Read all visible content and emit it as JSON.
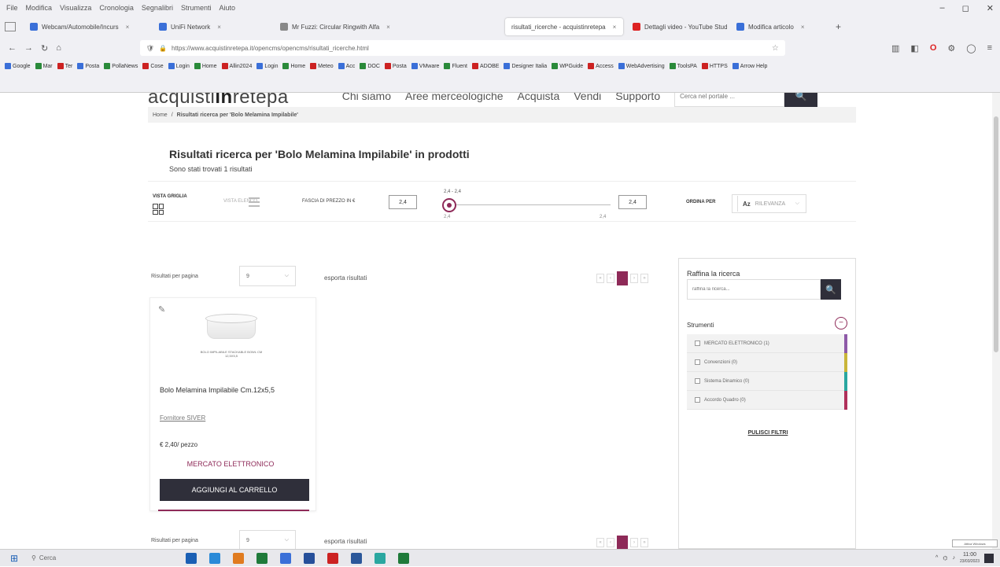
{
  "browser": {
    "menu": [
      "File",
      "Modifica",
      "Visualizza",
      "Cronologia",
      "Segnalibri",
      "Strumenti",
      "Aiuto"
    ],
    "window_controls": [
      "–",
      "◻",
      "✕"
    ],
    "tabs": [
      {
        "label": "Webcam/Automobile/Incurs",
        "active": false
      },
      {
        "label": "UniFi Network",
        "active": false
      },
      {
        "label": "Mr Fuzzi: Circular Ringwith Alfa",
        "active": false
      },
      {
        "label": "risultati_ricerche - acquistinretepa",
        "active": true
      },
      {
        "label": "Dettagli video - YouTube Studio",
        "active": false
      },
      {
        "label": "Modifica articolo",
        "active": false
      }
    ],
    "url": "https://www.acquistinretepa.it/opencms/opencms/risultati_ricerche.html",
    "bookmarks": [
      "Google",
      "Mar",
      "Ter",
      "Posta",
      "PollaNews",
      "Cose",
      "Login",
      "Home",
      "Allin2024",
      "Login",
      "Home",
      "Meteo",
      "Acc",
      "DOC",
      "Posta",
      "VMware",
      "Fluent",
      "ADOBE",
      "Designer Italia",
      "WPGuide",
      "Access",
      "WebAdvertising",
      "ToolsPA",
      "HTTPS",
      "Arrow Help"
    ]
  },
  "site": {
    "logo_left": "acquisti",
    "logo_mid": "in",
    "logo_right": "retepa",
    "nav": [
      "Chi siamo",
      "Aree merceologiche",
      "Acquista",
      "Vendi",
      "Supporto"
    ],
    "search_placeholder": "Cerca nel portale ...",
    "breadcrumb_home": "Home",
    "breadcrumb_sep": "/",
    "breadcrumb_current": "Risultati ricerca per 'Bolo Melamina Impilabile'"
  },
  "results": {
    "title": "Risultati ricerca per 'Bolo Melamina Impilabile' in prodotti",
    "subtitle": "Sono stati trovati 1 risultati"
  },
  "filters": {
    "grid_view_label": "VISTA GRIGLIA",
    "list_view_label": "VISTA ELENCO",
    "price_range_label": "FASCIA DI PREZZO IN €",
    "price_min": "2,4",
    "price_max": "2,4",
    "range_text": "2,4 - 2,4",
    "range_min_text": "2,4",
    "range_max_text": "2,4",
    "sort_label": "ORDINA PER",
    "sort_value": "RILEVANZA",
    "sort_icon_text": "Az"
  },
  "pagination_top": {
    "per_page_label": "Risultati per pagina",
    "per_page_value": "9",
    "export_label": "esporta risultati",
    "pages": [
      "«",
      "‹",
      "1",
      "›",
      "»"
    ]
  },
  "pagination_bottom": {
    "per_page_label": "Risultati per pagina",
    "per_page_value": "9",
    "export_label": "esporta risultati",
    "pages": [
      "«",
      "‹",
      "1",
      "›",
      "»"
    ]
  },
  "product": {
    "image_caption": "BOLO IMPILABILE STACKABLE BOWL CM 12,5X5,5",
    "name": "Bolo Melamina Impilabile Cm.12x5,5",
    "supplier": "Fornitore SIVER",
    "price": "€ 2,40/ pezzo",
    "market": "MERCATO ELETTRONICO",
    "add_to_cart": "AGGIUNGI AL CARRELLO"
  },
  "sidebar": {
    "refine_title": "Raffina la ricerca",
    "refine_placeholder": "raffina la ricerca...",
    "strumenti_label": "Strumenti",
    "options": [
      {
        "label": "MERCATO ELETTRONICO (1)",
        "color": "#8e5aa8"
      },
      {
        "label": "Convenzioni (0)",
        "color": "#c9b63a"
      },
      {
        "label": "Sistema Dinamico (0)",
        "color": "#2aa7a0"
      },
      {
        "label": "Accordo Quadro (0)",
        "color": "#b0305a"
      }
    ],
    "reset_label": "PULISCI FILTRI"
  },
  "taskbar": {
    "search_label": "Cerca",
    "time": "11:00",
    "date": "23/03/2023",
    "notice": "Attiva Windows"
  },
  "colors": {
    "accent": "#8e2a58",
    "dark_button": "#2f2f3a"
  }
}
